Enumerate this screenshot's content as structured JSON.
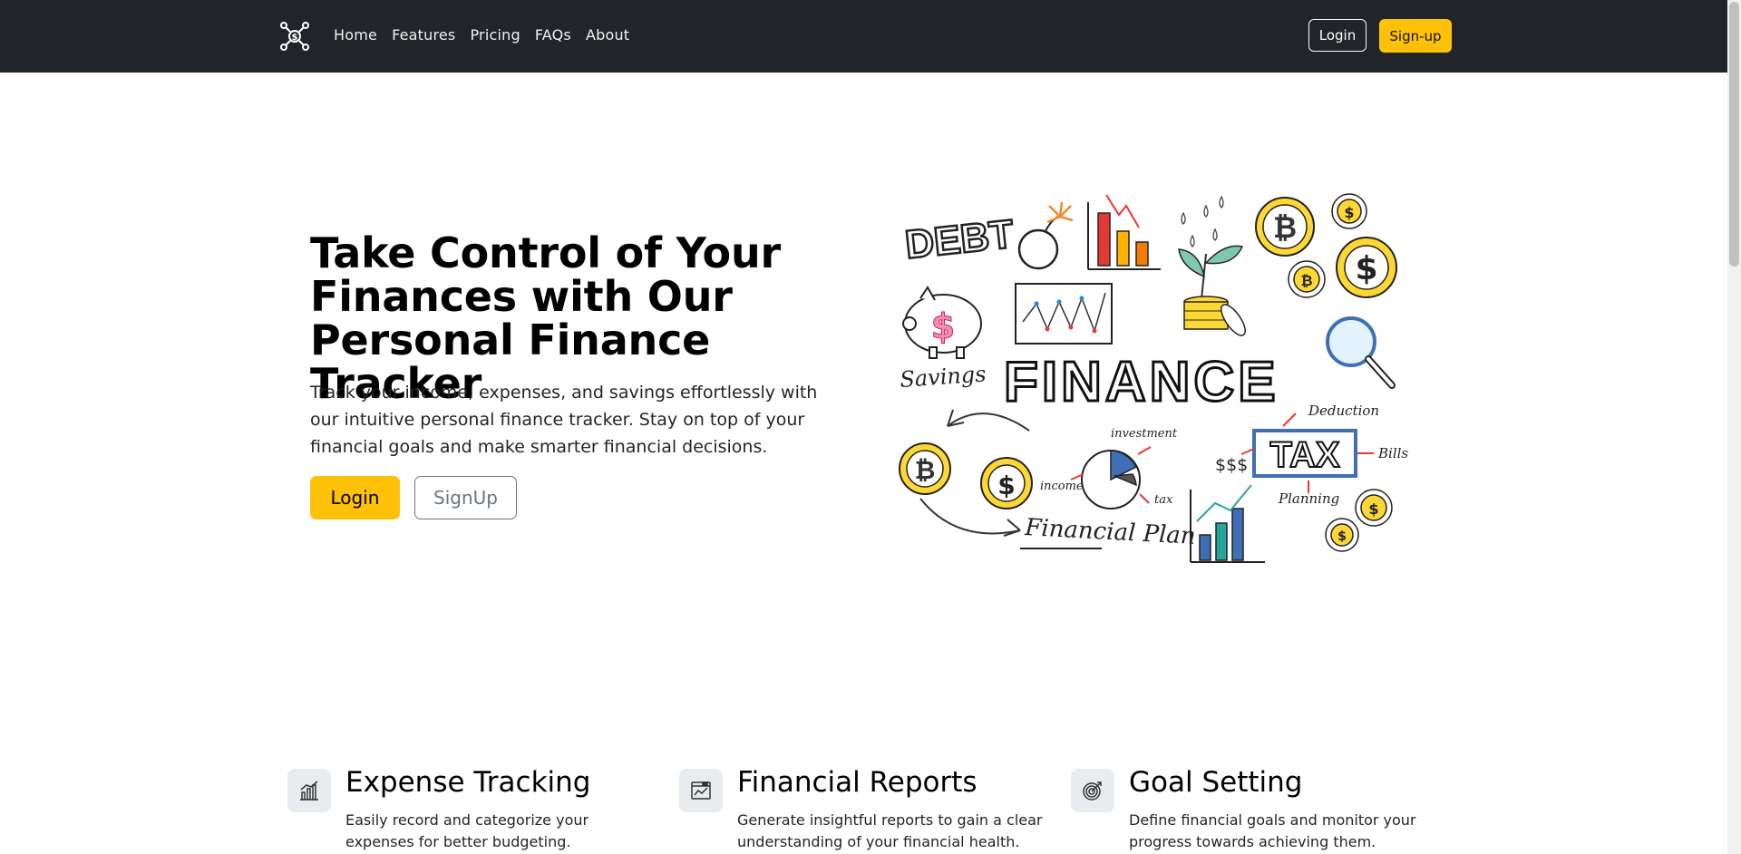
{
  "navbar": {
    "logo_icon": "network-dollar-icon",
    "links": [
      "Home",
      "Features",
      "Pricing",
      "FAQs",
      "About"
    ],
    "login_label": "Login",
    "signup_label": "Sign-up"
  },
  "hero": {
    "title": "Take Control of Your Finances with Our Personal Finance Tracker",
    "text": "Track your income, expenses, and savings effortlessly with our intuitive personal finance tracker. Stay on top of your financial goals and make smarter financial decisions.",
    "login_label": "Login",
    "signup_label": "SignUp"
  },
  "illustration": {
    "debt": "DEBT",
    "finance": "FINANCE",
    "savings": "Savings",
    "tax": "TAX",
    "deduction": "Deduction",
    "bills": "Bills",
    "planning": "Planning",
    "dollars": "$$$",
    "investment": "investment",
    "income": "income",
    "tax_small": "tax",
    "financial_plan": "Financial Plan"
  },
  "features": [
    {
      "icon": "bar-chart-icon",
      "title": "Expense Tracking",
      "desc": "Easily record and categorize your expenses for better budgeting."
    },
    {
      "icon": "report-icon",
      "title": "Financial Reports",
      "desc": "Generate insightful reports to gain a clear understanding of your financial health."
    },
    {
      "icon": "target-icon",
      "title": "Goal Setting",
      "desc": "Define financial goals and monitor your progress towards achieving them."
    }
  ],
  "colors": {
    "navbar_bg": "#212529",
    "accent": "#ffc107",
    "secondary": "#6c757d"
  }
}
